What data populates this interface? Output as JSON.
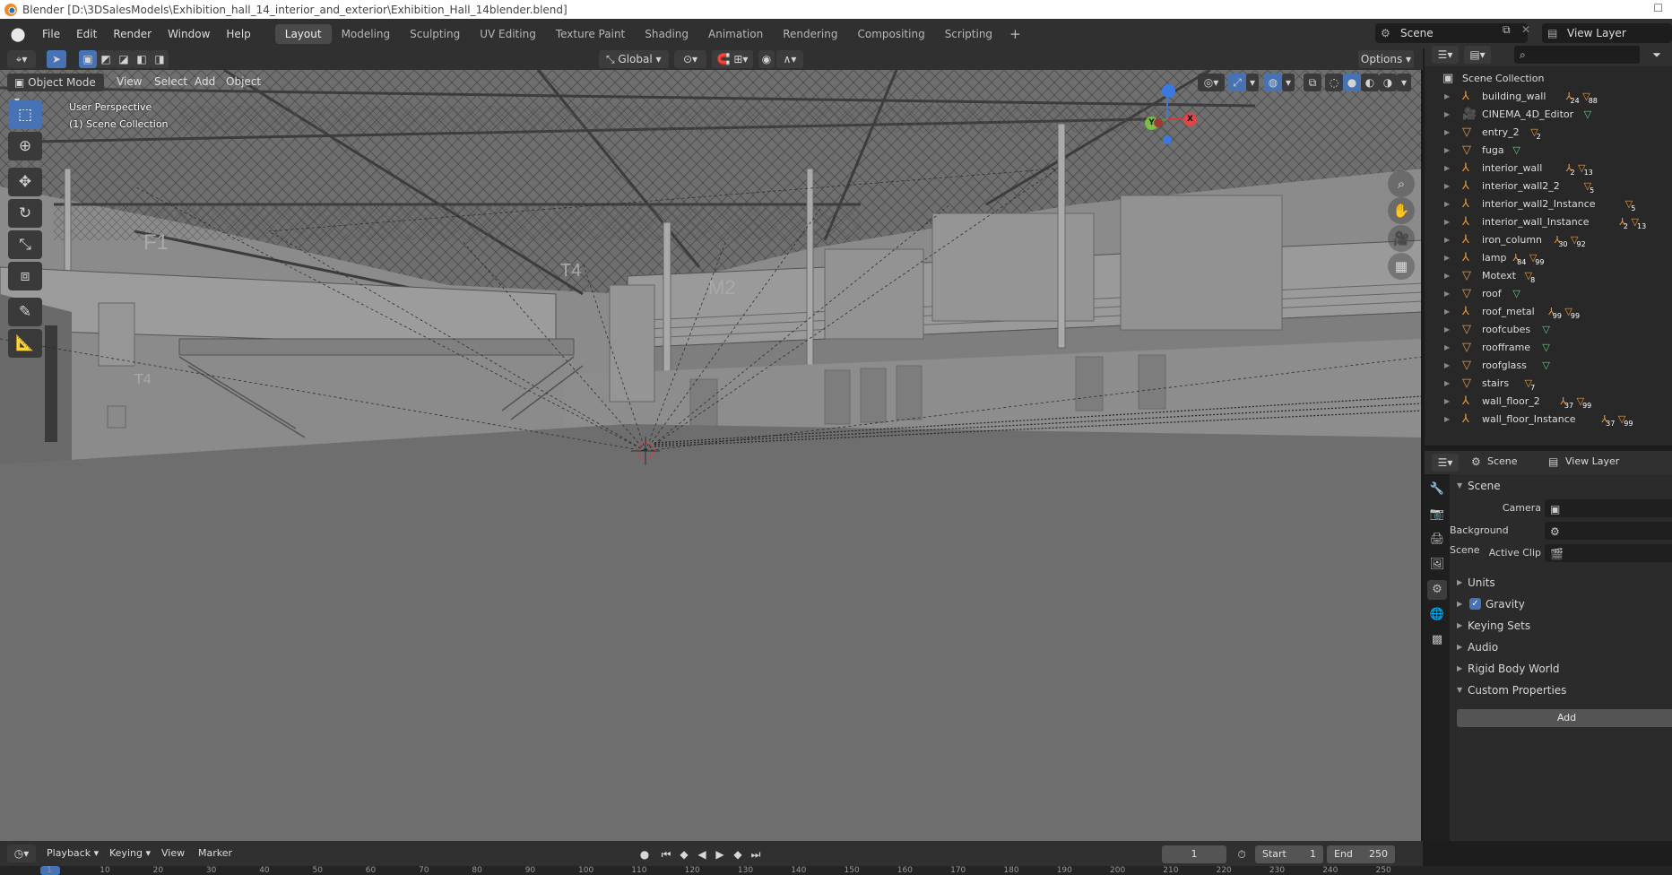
{
  "window": {
    "title": "Blender [D:\\3DSalesModels\\Exhibition_hall_14_interior_and_exterior\\Exhibition_Hall_14blender.blend]"
  },
  "menubar": {
    "items": [
      "File",
      "Edit",
      "Render",
      "Window",
      "Help"
    ],
    "workspaces": [
      "Layout",
      "Modeling",
      "Sculpting",
      "UV Editing",
      "Texture Paint",
      "Shading",
      "Animation",
      "Rendering",
      "Compositing",
      "Scripting"
    ],
    "active_workspace": "Layout",
    "scene": "Scene",
    "view_layer": "View Layer"
  },
  "viewport_header": {
    "transform_orientation": "Global",
    "options_label": "Options",
    "mode": "Object Mode",
    "menus": [
      "View",
      "Select",
      "Add",
      "Object"
    ]
  },
  "viewport": {
    "perspective_label": "User Perspective",
    "collection_label": "(1) Scene Collection",
    "gizmo": {
      "x": "X",
      "y": "Y",
      "z": "Z"
    }
  },
  "tools": [
    "select-box",
    "cursor",
    "move",
    "rotate",
    "scale",
    "transform",
    "annotate",
    "measure"
  ],
  "outliner": {
    "root": "Scene Collection",
    "items": [
      {
        "name": "building_wall",
        "type": "empty",
        "badges": [
          "24",
          "88"
        ]
      },
      {
        "name": "CINEMA_4D_Editor",
        "type": "camera",
        "badges": []
      },
      {
        "name": "entry_2",
        "type": "mesh",
        "badges": [
          "2"
        ]
      },
      {
        "name": "fuga",
        "type": "mesh",
        "badges": []
      },
      {
        "name": "interior_wall",
        "type": "empty",
        "badges": [
          "2",
          "13"
        ]
      },
      {
        "name": "interior_wall2_2",
        "type": "empty",
        "badges": [
          "5"
        ]
      },
      {
        "name": "interior_wall2_Instance",
        "type": "empty",
        "badges": [
          "5"
        ]
      },
      {
        "name": "interior_wall_Instance",
        "type": "empty",
        "badges": [
          "2",
          "13"
        ]
      },
      {
        "name": "iron_column",
        "type": "empty",
        "badges": [
          "30",
          "92"
        ]
      },
      {
        "name": "lamp",
        "type": "empty",
        "badges": [
          "84",
          "99"
        ]
      },
      {
        "name": "Motext",
        "type": "mesh",
        "badges": [
          "8"
        ]
      },
      {
        "name": "roof",
        "type": "mesh",
        "badges": []
      },
      {
        "name": "roof_metal",
        "type": "empty",
        "badges": [
          "99",
          "99"
        ]
      },
      {
        "name": "roofcubes",
        "type": "mesh",
        "badges": []
      },
      {
        "name": "roofframe",
        "type": "mesh",
        "badges": []
      },
      {
        "name": "roofglass",
        "type": "mesh",
        "badges": []
      },
      {
        "name": "stairs",
        "type": "mesh",
        "badges": [
          "7"
        ]
      },
      {
        "name": "wall_floor_2",
        "type": "empty",
        "badges": [
          "37",
          "99"
        ]
      },
      {
        "name": "wall_floor_Instance",
        "type": "empty",
        "badges": [
          "37",
          "99"
        ]
      }
    ]
  },
  "properties": {
    "header_scene": "Scene",
    "header_view_layer": "View Layer",
    "panel_title": "Scene",
    "fields": [
      {
        "label": "Camera"
      },
      {
        "label": "Background Scene"
      },
      {
        "label": "Active Clip"
      }
    ],
    "sections": [
      "Units",
      "Gravity",
      "Keying Sets",
      "Audio",
      "Rigid Body World",
      "Custom Properties"
    ],
    "add_label": "Add"
  },
  "timeline": {
    "menus": [
      "Playback",
      "Keying",
      "View",
      "Marker"
    ],
    "current_frame": "1",
    "start_label": "Start",
    "start": "1",
    "end_label": "End",
    "end": "250",
    "ticks": [
      "1",
      "10",
      "20",
      "30",
      "40",
      "50",
      "60",
      "70",
      "80",
      "90",
      "100",
      "110",
      "120",
      "130",
      "140",
      "150",
      "160",
      "170",
      "180",
      "190",
      "200",
      "210",
      "220",
      "230",
      "240",
      "250"
    ]
  },
  "colors": {
    "accent": "#4772b3",
    "object_orange": "#e59a48",
    "viewport_bg": "#7a7a7a"
  }
}
